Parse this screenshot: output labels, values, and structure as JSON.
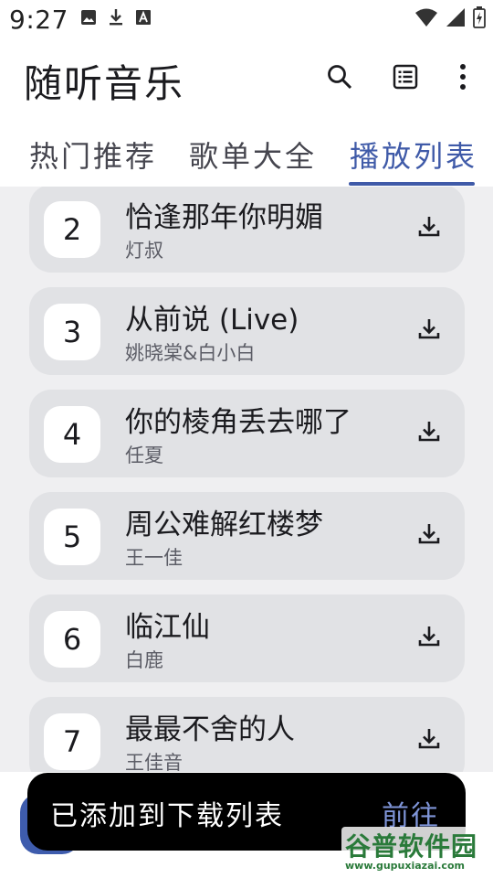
{
  "status_bar": {
    "time": "9:27",
    "left_icons": [
      "image-icon",
      "download-icon",
      "text-icon"
    ],
    "right_icons": [
      "wifi-icon",
      "signal-icon",
      "battery-icon"
    ]
  },
  "app_bar": {
    "title": "随听音乐",
    "actions": [
      "search-icon",
      "list-icon",
      "more-vert-icon"
    ]
  },
  "tabs": [
    {
      "label": "热门推荐",
      "active": false
    },
    {
      "label": "歌单大全",
      "active": false
    },
    {
      "label": "播放列表",
      "active": true
    }
  ],
  "songs": [
    {
      "rank": "2",
      "title": "恰逢那年你明媚",
      "artist": "灯叔"
    },
    {
      "rank": "3",
      "title": "从前说 (Live)",
      "artist": "姚晓棠&白小白"
    },
    {
      "rank": "4",
      "title": "你的棱角丢去哪了",
      "artist": "任夏"
    },
    {
      "rank": "5",
      "title": "周公难解红楼梦",
      "artist": "王一佳"
    },
    {
      "rank": "6",
      "title": "临江仙",
      "artist": "白鹿"
    },
    {
      "rank": "7",
      "title": "最最不舍的人",
      "artist": "王佳音"
    }
  ],
  "snackbar": {
    "message": "已添加到下载列表",
    "action": "前往"
  },
  "watermark": {
    "brand": "谷普软件园",
    "url": "www.gupuxiazai.com"
  },
  "colors": {
    "accent": "#3f5aa8",
    "card": "#e1e2e5",
    "list_bg": "#efeff1",
    "snackbar_bg": "#000000",
    "snackbar_action": "#7f95d8"
  }
}
